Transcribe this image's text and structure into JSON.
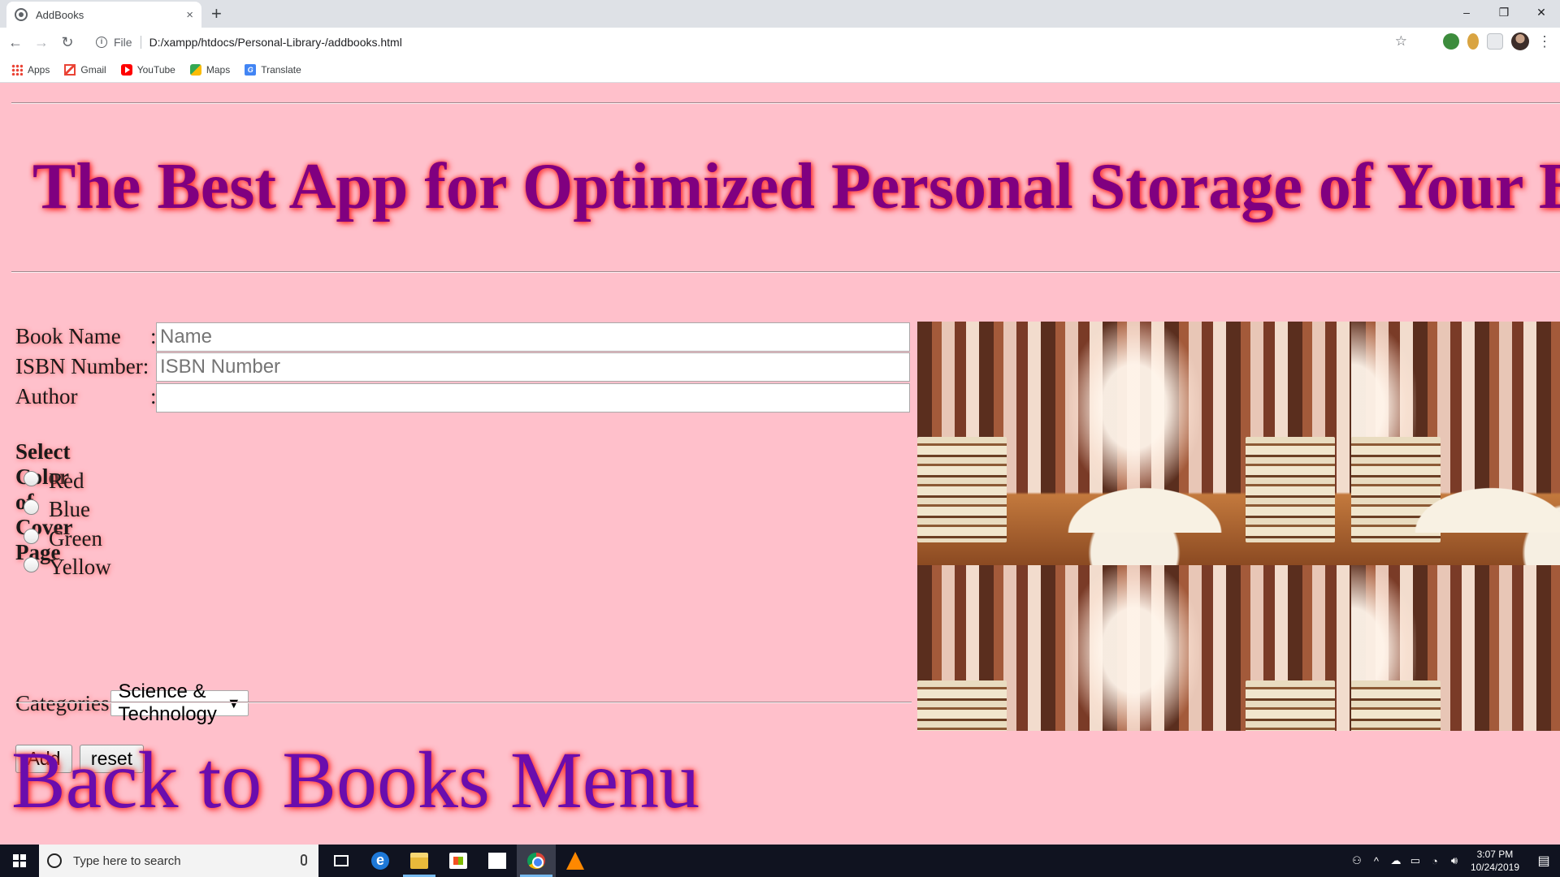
{
  "browser": {
    "tab_title": "AddBooks",
    "tab_close": "×",
    "new_tab": "+",
    "window_controls": [
      "–",
      "❐",
      "✕"
    ],
    "url_scheme": "File",
    "url": "D:/xampp/htdocs/Personal-Library-/addbooks.html",
    "bookmarks": [
      "Apps",
      "Gmail",
      "YouTube",
      "Maps",
      "Translate"
    ]
  },
  "page": {
    "headline": "The Best App for Optimized Personal Storage of Your Books",
    "form": {
      "book_name_label": "Book Name",
      "book_name_placeholder": "Name",
      "isbn_label": "ISBN Number:",
      "isbn_placeholder": "ISBN Number",
      "author_label": "Author",
      "author_value": "",
      "colon": ":",
      "color_section_title": "Select Color of Cover Page",
      "color_options": [
        "Red",
        "Blue",
        "Green",
        "Yellow"
      ],
      "categories_label": "Categories",
      "categories_selected": "Science & Technology",
      "add_button": "Add",
      "reset_button": "reset"
    },
    "back_link": "Back to Books Menu",
    "colors": {
      "background": "#ffc0cb",
      "headline": "#800080",
      "back_link": "#6a0dad",
      "glow": "#ff3333"
    }
  },
  "taskbar": {
    "search_placeholder": "Type here to search",
    "time": "3:07 PM",
    "date": "10/24/2019"
  }
}
